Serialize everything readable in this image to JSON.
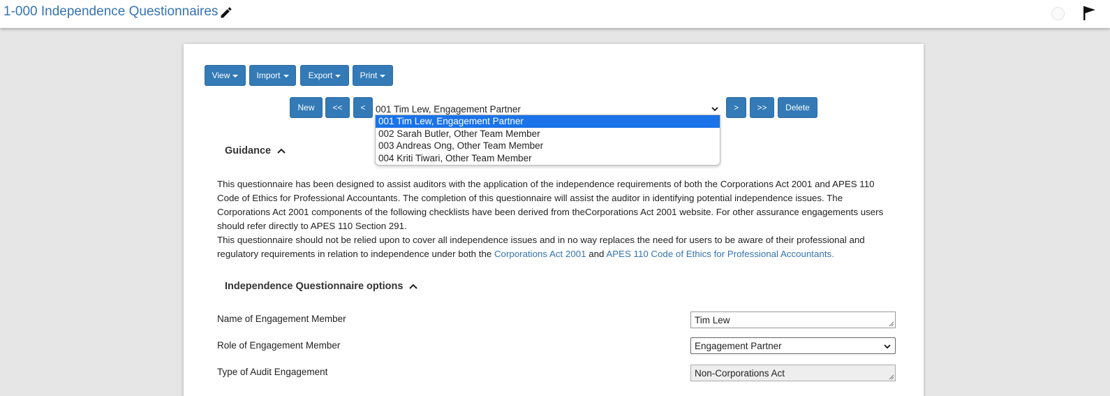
{
  "header": {
    "title": "1-000 Independence Questionnaires",
    "edit_icon": "pencil-icon",
    "status_icon": "circle-status-icon",
    "flag_icon": "flag-icon"
  },
  "toolbar": {
    "view_label": "View",
    "import_label": "Import",
    "export_label": "Export",
    "print_label": "Print"
  },
  "navigator": {
    "new_label": "New",
    "first_label": "<<",
    "prev_label": "<",
    "next_label": ">",
    "last_label": ">>",
    "delete_label": "Delete",
    "selected_record": "001 Tim Lew, Engagement Partner",
    "options": [
      "001 Tim Lew, Engagement Partner",
      "002 Sarah Butler, Other Team Member",
      "003 Andreas Ong, Other Team Member",
      "004 Kriti Tiwari, Other Team Member"
    ]
  },
  "guidance": {
    "heading": "Guidance",
    "paragraph1": "This questionnaire has been designed to assist auditors with the application of the independence requirements of both the Corporations Act 2001 and APES 110 Code of Ethics for Professional Accountants. The completion of this questionnaire will assist the auditor in identifying potential independence issues. The Corporations Act 2001 components of the following checklists have been derived from theCorporations Act 2001 website. For other assurance engagements users should refer directly to APES 110 Section 291.",
    "paragraph2_prefix": "This questionnaire should not be relied upon to cover all independence issues and in no way replaces the need for users to be aware of their professional and regulatory requirements in relation to independence under both the ",
    "link1": "Corporations Act 2001",
    "joiner": " and ",
    "link2": "APES 110 Code of Ethics for Professional Accountants."
  },
  "options_section": {
    "heading": "Independence Questionnaire options",
    "fields": [
      {
        "label": "Name of Engagement Member",
        "value": "Tim Lew"
      },
      {
        "label": "Role of Engagement Member",
        "value": "Engagement Partner"
      },
      {
        "label": "Type of Audit Engagement",
        "value": "Non-Corporations Act"
      }
    ]
  },
  "colors": {
    "primary_button": "#337ab7",
    "link": "#3573b0",
    "selected_option": "#1a73e8"
  }
}
